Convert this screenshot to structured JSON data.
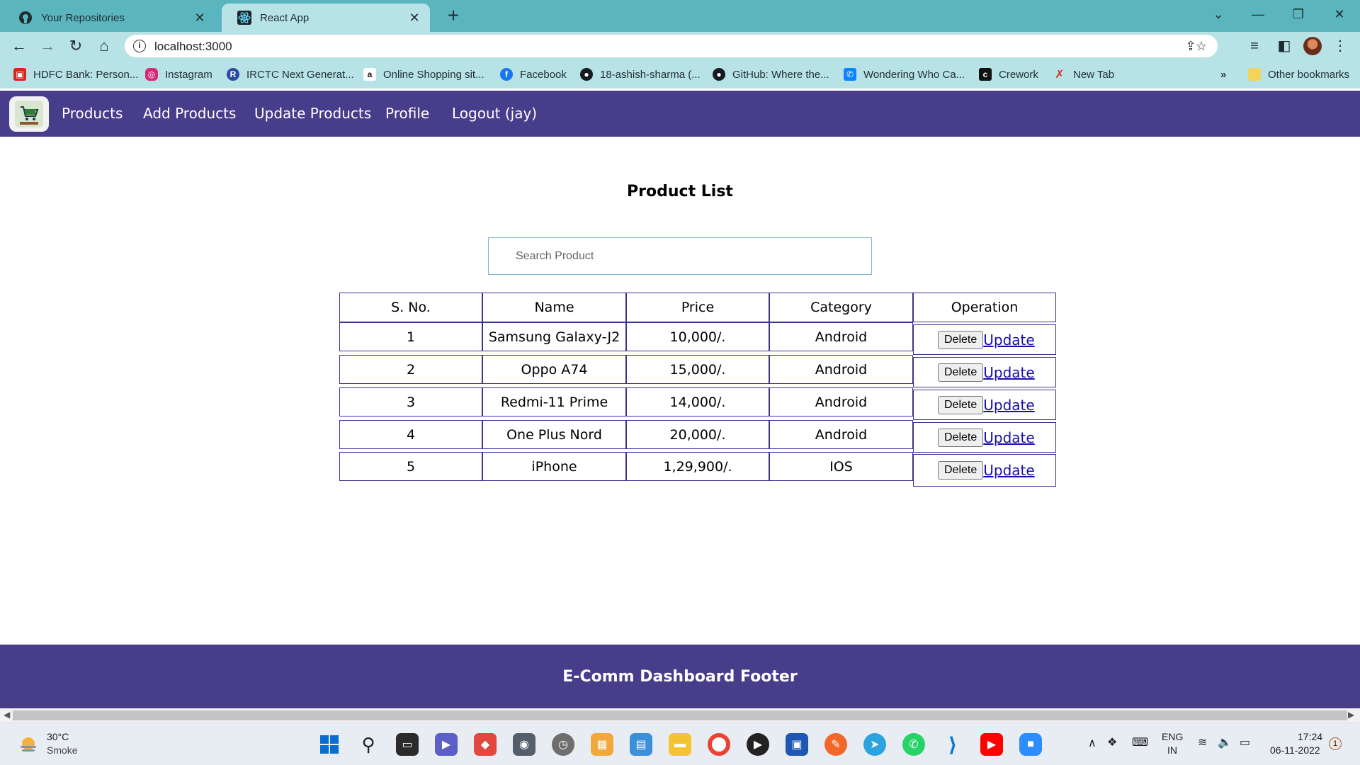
{
  "browser": {
    "tabs": [
      {
        "title": "Your Repositories",
        "icon": "github-icon"
      },
      {
        "title": "React App",
        "icon": "react-icon"
      }
    ],
    "url": "localhost:3000",
    "bookmarks": [
      {
        "label": "HDFC Bank: Person...",
        "icon": "hdfc-icon",
        "color": "#d7261e"
      },
      {
        "label": "Instagram",
        "icon": "instagram-icon",
        "color": "#d62976"
      },
      {
        "label": "IRCTC Next Generat...",
        "icon": "irctc-icon",
        "color": "#2d4aa1"
      },
      {
        "label": "Online Shopping sit...",
        "icon": "amazon-icon",
        "color": "#111111"
      },
      {
        "label": "Facebook",
        "icon": "facebook-icon",
        "color": "#1877f2"
      },
      {
        "label": "18-ashish-sharma (...",
        "icon": "github-icon",
        "color": "#161b22"
      },
      {
        "label": "GitHub: Where the...",
        "icon": "github-icon",
        "color": "#161b22"
      },
      {
        "label": "Wondering Who Ca...",
        "icon": "truecaller-icon",
        "color": "#0a84ff"
      },
      {
        "label": "Crework",
        "icon": "crework-icon",
        "color": "#111111"
      },
      {
        "label": "New Tab",
        "icon": "newtab-icon",
        "color": "#d92d20"
      }
    ],
    "bookmarks_overflow": "»",
    "other_bookmarks": "Other bookmarks"
  },
  "nav": {
    "links": [
      "Products",
      "Add Products",
      "Update Products",
      "Profile",
      "Logout (jay)"
    ]
  },
  "main": {
    "title": "Product List",
    "search_placeholder": "Search Product",
    "table": {
      "headers": [
        "S. No.",
        "Name",
        "Price",
        "Category",
        "Operation"
      ],
      "rows": [
        {
          "sno": "1",
          "name": "Samsung Galaxy-J2",
          "price": "10,000/.",
          "category": "Android"
        },
        {
          "sno": "2",
          "name": "Oppo A74",
          "price": "15,000/.",
          "category": "Android"
        },
        {
          "sno": "3",
          "name": "Redmi-11 Prime",
          "price": "14,000/.",
          "category": "Android"
        },
        {
          "sno": "4",
          "name": "One Plus Nord",
          "price": "20,000/.",
          "category": "Android"
        },
        {
          "sno": "5",
          "name": "iPhone",
          "price": "1,29,900/.",
          "category": "IOS"
        }
      ],
      "delete_label": "Delete",
      "update_label": "Update"
    }
  },
  "footer": {
    "text": "E-Comm Dashboard Footer"
  },
  "taskbar": {
    "weather_temp": "30°C",
    "weather_desc": "Smoke",
    "lang": "ENG",
    "region": "IN",
    "time": "17:24",
    "date": "06-11-2022",
    "notification_count": "1"
  },
  "colors": {
    "nav_bg": "#483d8b",
    "table_border": "#3b3392",
    "chrome_tabstrip": "#5ab5bf",
    "chrome_toolbar": "#b7e3e7"
  }
}
